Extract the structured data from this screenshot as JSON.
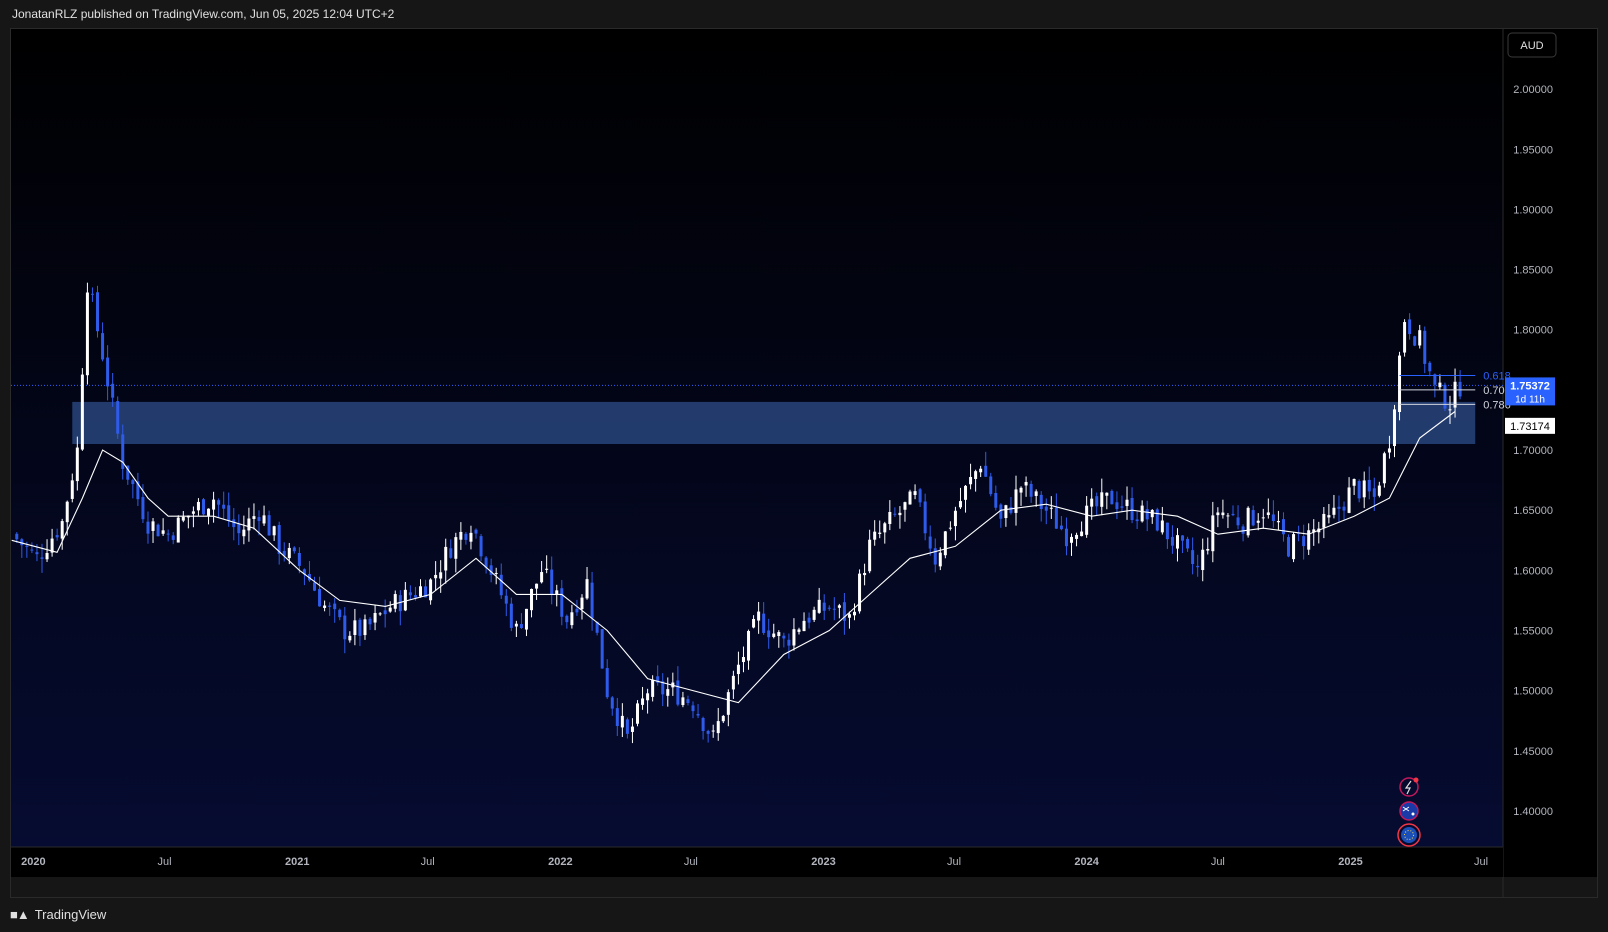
{
  "header": {
    "publisher": "JonatanRLZ published on TradingView.com, Jun 05, 2025 12:04 UTC+2"
  },
  "footer": {
    "brand": "TradingView",
    "logo_icon": "tradingview-logo-icon"
  },
  "currency_button": "AUD",
  "colors": {
    "bg": "#000000",
    "panel_bottom": "#060c33",
    "up": "#ffffff",
    "down": "#2f5bea",
    "zone": "#2d4d8a",
    "ma": "#ffffff",
    "current_line": "#2962ff"
  },
  "chart_data": {
    "type": "candlestick",
    "timeframe": "weekly",
    "x_start": "2019-12",
    "x_end": "2025-07",
    "x_ticks": [
      {
        "label": "2020",
        "date": "2020-01-01"
      },
      {
        "label": "Jul",
        "date": "2020-07-01"
      },
      {
        "label": "2021",
        "date": "2021-01-01"
      },
      {
        "label": "Jul",
        "date": "2021-07-01"
      },
      {
        "label": "2022",
        "date": "2022-01-01"
      },
      {
        "label": "Jul",
        "date": "2022-07-01"
      },
      {
        "label": "2023",
        "date": "2023-01-01"
      },
      {
        "label": "Jul",
        "date": "2023-07-01"
      },
      {
        "label": "2024",
        "date": "2024-01-01"
      },
      {
        "label": "Jul",
        "date": "2024-07-01"
      },
      {
        "label": "2025",
        "date": "2025-01-01"
      },
      {
        "label": "Jul",
        "date": "2025-07-01"
      }
    ],
    "y_ticks": [
      "2.00000",
      "1.95000",
      "1.90000",
      "1.85000",
      "1.80000",
      "1.75000",
      "1.70000",
      "1.65000",
      "1.60000",
      "1.55000",
      "1.50000",
      "1.45000",
      "1.40000"
    ],
    "ylim": [
      1.37,
      2.05
    ],
    "close_path": [
      [
        "2019-12-02",
        1.63
      ],
      [
        "2020-01-06",
        1.61
      ],
      [
        "2020-02-10",
        1.64
      ],
      [
        "2020-03-02",
        1.7
      ],
      [
        "2020-03-16",
        1.84
      ],
      [
        "2020-04-06",
        1.78
      ],
      [
        "2020-05-04",
        1.69
      ],
      [
        "2020-06-08",
        1.64
      ],
      [
        "2020-07-06",
        1.63
      ],
      [
        "2020-08-10",
        1.65
      ],
      [
        "2020-09-07",
        1.66
      ],
      [
        "2020-10-12",
        1.63
      ],
      [
        "2020-11-09",
        1.65
      ],
      [
        "2020-12-07",
        1.62
      ],
      [
        "2021-01-11",
        1.6
      ],
      [
        "2021-02-08",
        1.57
      ],
      [
        "2021-03-08",
        1.55
      ],
      [
        "2021-04-05",
        1.55
      ],
      [
        "2021-05-10",
        1.57
      ],
      [
        "2021-06-07",
        1.58
      ],
      [
        "2021-07-05",
        1.59
      ],
      [
        "2021-08-02",
        1.62
      ],
      [
        "2021-08-30",
        1.64
      ],
      [
        "2021-10-04",
        1.59
      ],
      [
        "2021-11-01",
        1.55
      ],
      [
        "2021-12-06",
        1.6
      ],
      [
        "2022-01-10",
        1.56
      ],
      [
        "2022-02-07",
        1.59
      ],
      [
        "2022-03-07",
        1.5
      ],
      [
        "2022-04-04",
        1.46
      ],
      [
        "2022-05-02",
        1.5
      ],
      [
        "2022-06-06",
        1.5
      ],
      [
        "2022-07-04",
        1.49
      ],
      [
        "2022-08-01",
        1.46
      ],
      [
        "2022-09-05",
        1.52
      ],
      [
        "2022-10-03",
        1.56
      ],
      [
        "2022-11-07",
        1.54
      ],
      [
        "2022-12-05",
        1.56
      ],
      [
        "2023-01-09",
        1.57
      ],
      [
        "2023-02-06",
        1.56
      ],
      [
        "2023-03-06",
        1.62
      ],
      [
        "2023-04-03",
        1.64
      ],
      [
        "2023-05-08",
        1.66
      ],
      [
        "2023-06-05",
        1.61
      ],
      [
        "2023-07-03",
        1.65
      ],
      [
        "2023-08-07",
        1.69
      ],
      [
        "2023-09-04",
        1.64
      ],
      [
        "2023-10-02",
        1.67
      ],
      [
        "2023-11-06",
        1.65
      ],
      [
        "2023-12-04",
        1.63
      ],
      [
        "2024-01-08",
        1.65
      ],
      [
        "2024-02-05",
        1.66
      ],
      [
        "2024-03-04",
        1.65
      ],
      [
        "2024-04-08",
        1.64
      ],
      [
        "2024-05-06",
        1.62
      ],
      [
        "2024-06-03",
        1.6
      ],
      [
        "2024-07-01",
        1.65
      ],
      [
        "2024-08-05",
        1.64
      ],
      [
        "2024-09-02",
        1.65
      ],
      [
        "2024-10-07",
        1.62
      ],
      [
        "2024-11-04",
        1.63
      ],
      [
        "2024-12-02",
        1.64
      ],
      [
        "2025-01-06",
        1.67
      ],
      [
        "2025-02-03",
        1.66
      ],
      [
        "2025-02-24",
        1.71
      ],
      [
        "2025-03-17",
        1.81
      ],
      [
        "2025-04-07",
        1.79
      ],
      [
        "2025-04-28",
        1.75
      ],
      [
        "2025-05-19",
        1.74
      ],
      [
        "2025-06-02",
        1.754
      ]
    ],
    "moving_average": {
      "color": "#ffffff",
      "points": [
        [
          "2019-12-02",
          1.625
        ],
        [
          "2020-02-03",
          1.615
        ],
        [
          "2020-03-09",
          1.66
        ],
        [
          "2020-04-06",
          1.7
        ],
        [
          "2020-05-04",
          1.69
        ],
        [
          "2020-06-08",
          1.66
        ],
        [
          "2020-07-06",
          1.645
        ],
        [
          "2020-09-07",
          1.645
        ],
        [
          "2020-11-02",
          1.635
        ],
        [
          "2021-01-04",
          1.6
        ],
        [
          "2021-03-01",
          1.575
        ],
        [
          "2021-05-03",
          1.57
        ],
        [
          "2021-07-05",
          1.58
        ],
        [
          "2021-09-06",
          1.61
        ],
        [
          "2021-11-01",
          1.58
        ],
        [
          "2022-01-03",
          1.58
        ],
        [
          "2022-03-07",
          1.55
        ],
        [
          "2022-05-02",
          1.51
        ],
        [
          "2022-07-04",
          1.5
        ],
        [
          "2022-09-05",
          1.49
        ],
        [
          "2022-11-07",
          1.53
        ],
        [
          "2023-01-09",
          1.55
        ],
        [
          "2023-03-06",
          1.58
        ],
        [
          "2023-05-01",
          1.61
        ],
        [
          "2023-07-03",
          1.62
        ],
        [
          "2023-09-04",
          1.65
        ],
        [
          "2023-11-06",
          1.655
        ],
        [
          "2024-01-08",
          1.645
        ],
        [
          "2024-03-04",
          1.65
        ],
        [
          "2024-05-06",
          1.645
        ],
        [
          "2024-07-01",
          1.63
        ],
        [
          "2024-09-02",
          1.635
        ],
        [
          "2024-11-04",
          1.63
        ],
        [
          "2025-01-06",
          1.645
        ],
        [
          "2025-02-24",
          1.66
        ],
        [
          "2025-04-07",
          1.71
        ],
        [
          "2025-05-26",
          1.732
        ]
      ]
    },
    "demand_zone": {
      "y_from": 1.705,
      "y_to": 1.74,
      "x_from": "2020-02-24",
      "x_to": "2025-06-23"
    },
    "fib_levels": [
      {
        "label": "0.618",
        "value": 1.762,
        "color": "#2962ff"
      },
      {
        "label": "0.702",
        "value": 1.75,
        "color": "#d1d4dc"
      },
      {
        "label": "0.786",
        "value": 1.738,
        "color": "#d1d4dc"
      }
    ],
    "fib_x_from": "2025-03-10",
    "fib_x_to": "2025-06-23",
    "current_price": {
      "label": "1.75372",
      "value": 1.75372,
      "countdown": "1d 11h",
      "color": "#2962ff"
    },
    "ma_price": {
      "label": "1.73174",
      "value": 1.73174
    }
  }
}
